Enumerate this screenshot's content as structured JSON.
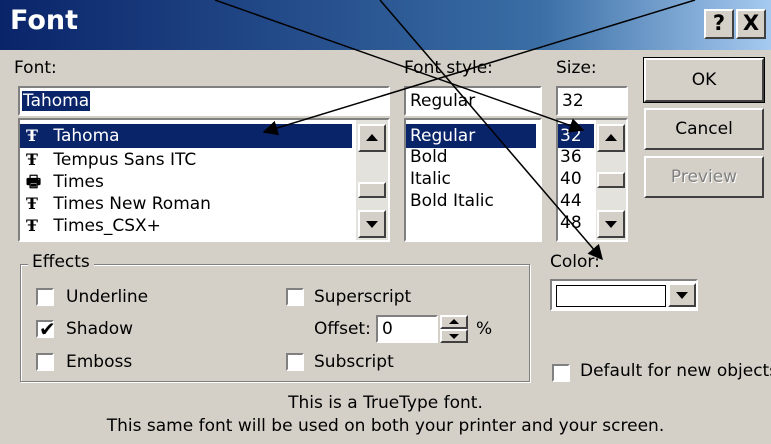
{
  "window": {
    "title": "Font",
    "help_label": "?",
    "close_label": "X"
  },
  "font": {
    "label": "Font:",
    "value": "Tahoma",
    "list": [
      "Tahoma",
      "Tempus Sans ITC",
      "Times",
      "Times New Roman",
      "Times_CSX+"
    ],
    "selected": "Tahoma"
  },
  "font_style": {
    "label": "Font style:",
    "value": "Regular",
    "list": [
      "Regular",
      "Bold",
      "Italic",
      "Bold Italic"
    ],
    "selected": "Regular"
  },
  "size": {
    "label": "Size:",
    "value": "32",
    "list": [
      "32",
      "36",
      "40",
      "44",
      "48"
    ],
    "selected": "32"
  },
  "buttons": {
    "ok": "OK",
    "cancel": "Cancel",
    "preview": "Preview"
  },
  "effects": {
    "label": "Effects",
    "underline": "Underline",
    "shadow": "Shadow",
    "emboss": "Emboss",
    "superscript": "Superscript",
    "subscript": "Subscript",
    "offset_label": "Offset:",
    "offset_value": "0",
    "percent": "%",
    "shadow_checked": "✔"
  },
  "color": {
    "label": "Color:",
    "value": ""
  },
  "default_label": "Default for new objects",
  "info": {
    "line1": "This is a TrueType font.",
    "line2": "This same font will be used on both your printer and your screen."
  },
  "icons": {
    "truetype": "truetype-font-icon",
    "printer": "printer-font-icon"
  }
}
